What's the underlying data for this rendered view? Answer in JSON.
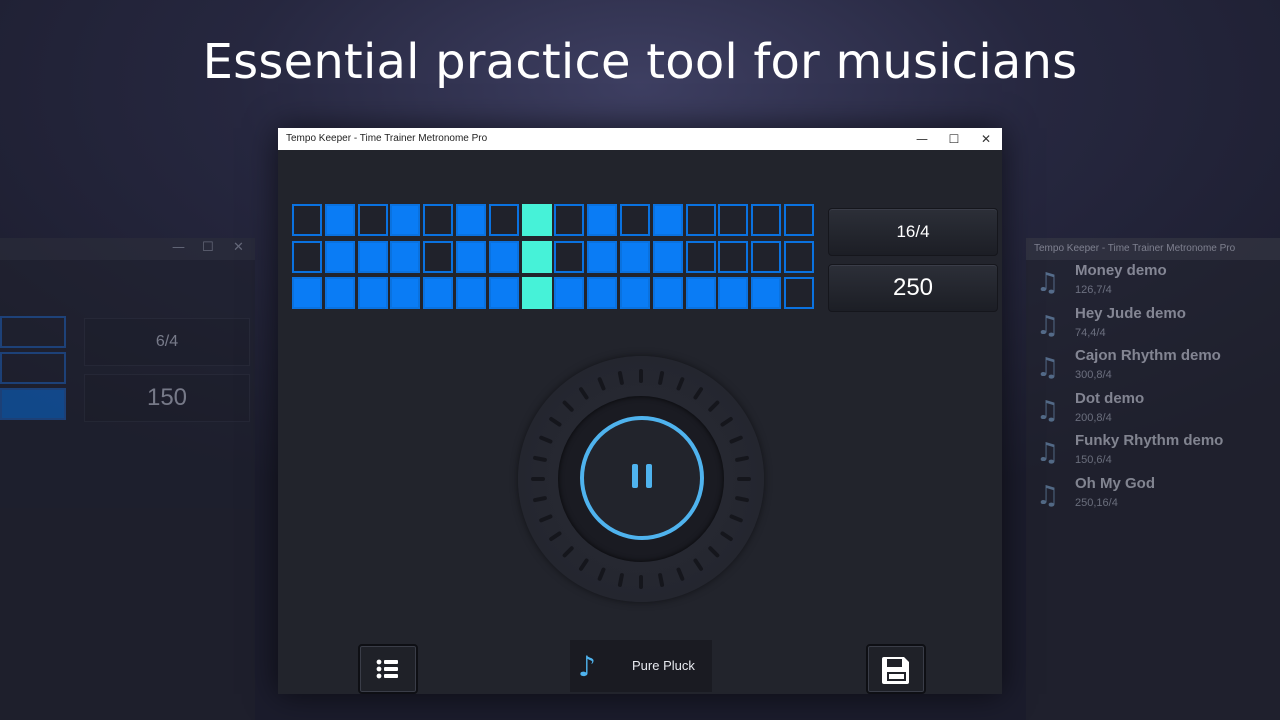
{
  "headline": "Essential practice tool for musicians",
  "window": {
    "title": "Tempo Keeper - Time Trainer Metronome Pro",
    "controls": {
      "minimize": "—",
      "maximize": "☐",
      "close": "✕"
    }
  },
  "pattern": {
    "columns": 16,
    "rows": [
      [
        0,
        1,
        0,
        1,
        0,
        1,
        0,
        1,
        0,
        1,
        0,
        1,
        0,
        0,
        0,
        0
      ],
      [
        0,
        1,
        1,
        1,
        0,
        1,
        1,
        1,
        0,
        1,
        1,
        1,
        0,
        0,
        0,
        0
      ],
      [
        1,
        1,
        1,
        1,
        1,
        1,
        1,
        1,
        1,
        1,
        1,
        1,
        1,
        1,
        1,
        0
      ]
    ],
    "active_column": 7
  },
  "meter": {
    "time_signature": "16/4",
    "tempo": "250"
  },
  "sound": {
    "icon": "music-note-icon",
    "name": "Pure Pluck"
  },
  "buttons": {
    "list": "list-icon",
    "save": "save-icon"
  },
  "left_ghost": {
    "time_signature": "6/4",
    "tempo": "150"
  },
  "right_ghost": {
    "title": "Tempo Keeper - Time Trainer Metronome Pro",
    "songs": [
      {
        "name": "Money demo",
        "meta": "126,7/4"
      },
      {
        "name": "Hey Jude demo",
        "meta": "74,4/4"
      },
      {
        "name": "Cajon Rhythm demo",
        "meta": "300,8/4"
      },
      {
        "name": "Dot demo",
        "meta": "200,8/4"
      },
      {
        "name": "Funky Rhythm demo",
        "meta": "150,6/4"
      },
      {
        "name": "Oh My God",
        "meta": "250,16/4"
      }
    ]
  },
  "colors": {
    "beat_on": "#0a7cf5",
    "beat_active": "#46f2d8",
    "accent": "#4fb3ee"
  }
}
